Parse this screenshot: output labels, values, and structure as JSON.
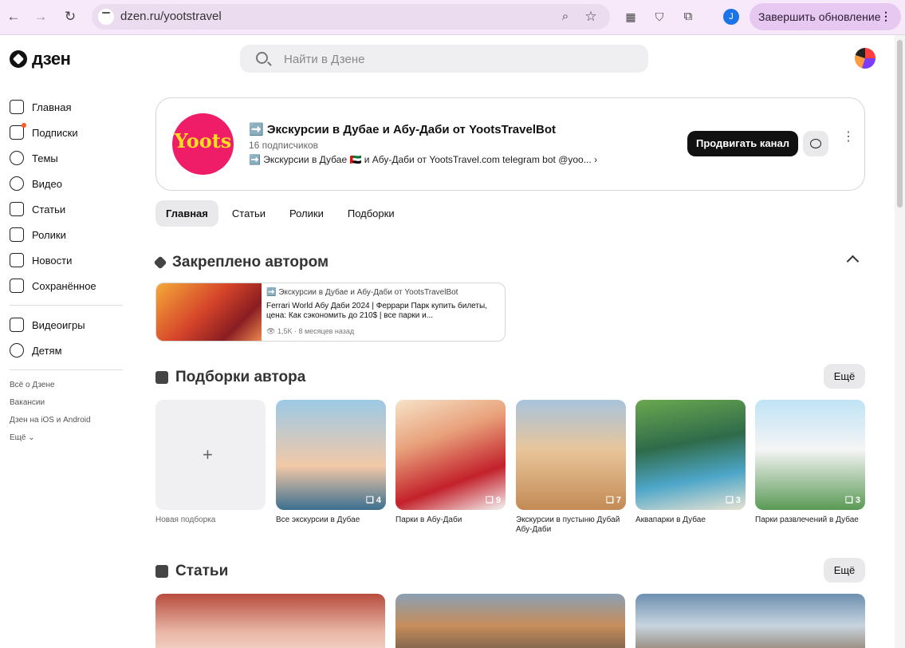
{
  "browser": {
    "url": "dzen.ru/yootstravel",
    "update_label": "Завершить обновление",
    "profile_letter": "J"
  },
  "header": {
    "logo": "дзен",
    "search_placeholder": "Найти в Дзене"
  },
  "sidebar": {
    "items": [
      {
        "label": "Главная",
        "icon": "home-icon"
      },
      {
        "label": "Подписки",
        "icon": "subscriptions-icon"
      },
      {
        "label": "Темы",
        "icon": "topics-icon"
      },
      {
        "label": "Видео",
        "icon": "video-icon"
      },
      {
        "label": "Статьи",
        "icon": "articles-icon"
      },
      {
        "label": "Ролики",
        "icon": "shorts-icon"
      },
      {
        "label": "Новости",
        "icon": "news-icon"
      },
      {
        "label": "Сохранённое",
        "icon": "bookmark-icon"
      }
    ],
    "extra": [
      {
        "label": "Видеоигры",
        "icon": "gamepad-icon"
      },
      {
        "label": "Детям",
        "icon": "kids-icon"
      }
    ],
    "footer_links": [
      "Всё о Дзене",
      "Вакансии",
      "Дзен на iOS и Android",
      "Ещё"
    ]
  },
  "channel": {
    "avatar_text": "Yoots",
    "title": "➡️ Экскурсии в Дубае и Абу-Даби от YootsTravelBot",
    "subscribers": "16 подписчиков",
    "description": "➡️ Экскурсии в Дубае 🇦🇪 и Абу-Даби от YootsTravel.com telegram bot @yoo...",
    "promote_label": "Продвигать канал"
  },
  "tabs": [
    "Главная",
    "Статьи",
    "Ролики",
    "Подборки"
  ],
  "pinned": {
    "heading": "Закреплено автором",
    "channel": "➡️ Экскурсии в Дубае и Абу-Даби от YootsTravelBot",
    "title": "Ferrari World Абу Даби 2024 | Феррари Парк купить билеты, цена: Как сэкономить до 210$ | все парки и...",
    "views": "1,5K",
    "age": "8 месяцев назад"
  },
  "collections": {
    "heading": "Подборки автора",
    "more_label": "Ещё",
    "new_label": "Новая подборка",
    "items": [
      {
        "label": "Все экскурсии в Дубае",
        "count": "4",
        "color": "#7fb3d8"
      },
      {
        "label": "Парки в Абу-Даби",
        "count": "9",
        "color": "#d5453a"
      },
      {
        "label": "Экскурсии в пустыню Дубай Абу-Даби",
        "count": "7",
        "color": "#c99a62"
      },
      {
        "label": "Аквапарки в Дубае",
        "count": "3",
        "color": "#3f8a5a"
      },
      {
        "label": "Парки развлечений в Дубае",
        "count": "3",
        "color": "#a9d6ee"
      }
    ]
  },
  "articles": {
    "heading": "Статьи",
    "more_label": "Ещё"
  }
}
